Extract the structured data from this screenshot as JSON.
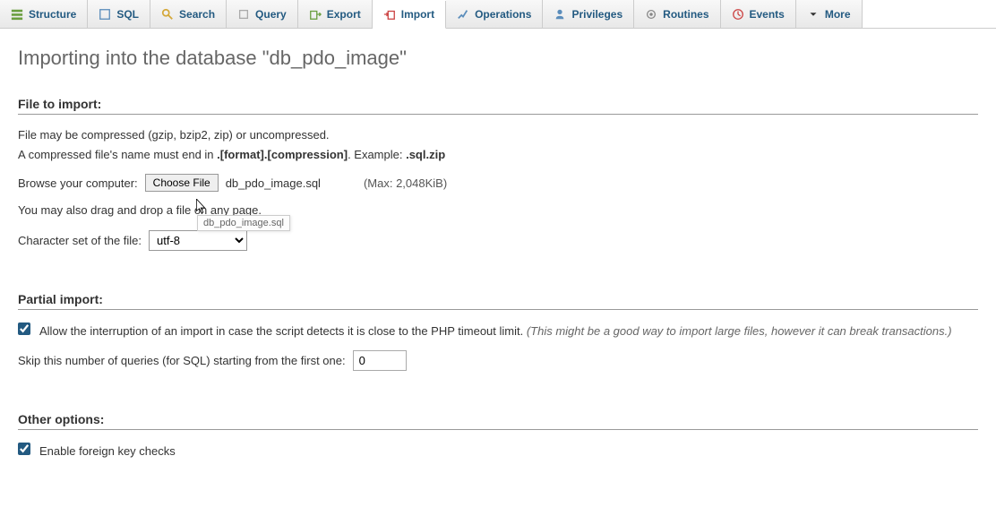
{
  "tabs": [
    {
      "label": "Structure",
      "icon": "structure"
    },
    {
      "label": "SQL",
      "icon": "sql"
    },
    {
      "label": "Search",
      "icon": "search"
    },
    {
      "label": "Query",
      "icon": "query"
    },
    {
      "label": "Export",
      "icon": "export"
    },
    {
      "label": "Import",
      "icon": "import",
      "active": true
    },
    {
      "label": "Operations",
      "icon": "operations"
    },
    {
      "label": "Privileges",
      "icon": "privileges"
    },
    {
      "label": "Routines",
      "icon": "routines"
    },
    {
      "label": "Events",
      "icon": "events"
    },
    {
      "label": "More",
      "icon": "more"
    }
  ],
  "page_title": "Importing into the database \"db_pdo_image\"",
  "file_section": {
    "header": "File to import:",
    "compress_info": "File may be compressed (gzip, bzip2, zip) or uncompressed.",
    "name_rule_prefix": "A compressed file's name must end in ",
    "name_rule_bold": ".[format].[compression]",
    "name_rule_mid": ". Example: ",
    "name_rule_example": ".sql.zip",
    "browse_label": "Browse your computer:",
    "choose_button": "Choose File",
    "selected_file": "db_pdo_image.sql",
    "max_size": "(Max: 2,048KiB)",
    "drag_info": "You may also drag and drop a file on any page.",
    "charset_label": "Character set of the file:",
    "charset_value": "utf-8",
    "tooltip": "db_pdo_image.sql"
  },
  "partial_section": {
    "header": "Partial import:",
    "allow_interrupt_checked": true,
    "allow_interrupt_text": "Allow the interruption of an import in case the script detects it is close to the PHP timeout limit. ",
    "allow_interrupt_hint": "(This might be a good way to import large files, however it can break transactions.)",
    "skip_label": "Skip this number of queries (for SQL) starting from the first one:",
    "skip_value": "0"
  },
  "other_section": {
    "header": "Other options:",
    "fk_checked": true,
    "fk_label": "Enable foreign key checks"
  }
}
